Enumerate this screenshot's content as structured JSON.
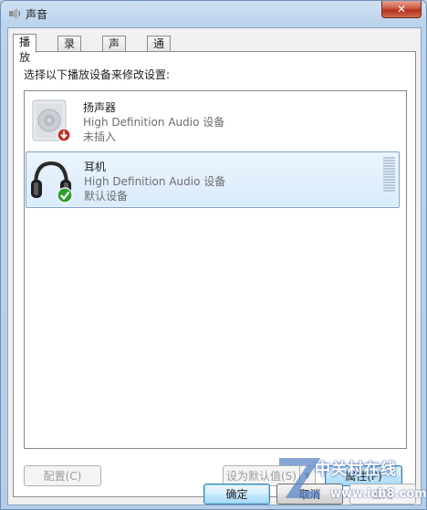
{
  "window": {
    "title": "声音",
    "close_label": "✕"
  },
  "tabs": [
    {
      "label": "播放",
      "active": true
    },
    {
      "label": "录制",
      "active": false
    },
    {
      "label": "声音",
      "active": false
    },
    {
      "label": "通信",
      "active": false
    }
  ],
  "panel": {
    "instruction": "选择以下播放设备来修改设置:"
  },
  "devices": [
    {
      "name": "扬声器",
      "driver": "High Definition Audio 设备",
      "status": "未插入",
      "icon": "speaker-icon",
      "badge": "unplugged-badge",
      "selected": false
    },
    {
      "name": "耳机",
      "driver": "High Definition Audio 设备",
      "status": "默认设备",
      "icon": "headphones-icon",
      "badge": "default-check-badge",
      "selected": true
    }
  ],
  "buttons": {
    "configure": "配置(C)",
    "set_default": "设为默认值(S)",
    "properties": "属性(P)",
    "ok": "确定",
    "cancel": "取消",
    "apply": "应用"
  },
  "watermark": {
    "text_cn": "中关村在线",
    "url": "www.ich8.com"
  },
  "colors": {
    "selection_border": "#7da2ce",
    "default_badge": "#2f9e2f",
    "unplugged_badge": "#c0302a"
  }
}
